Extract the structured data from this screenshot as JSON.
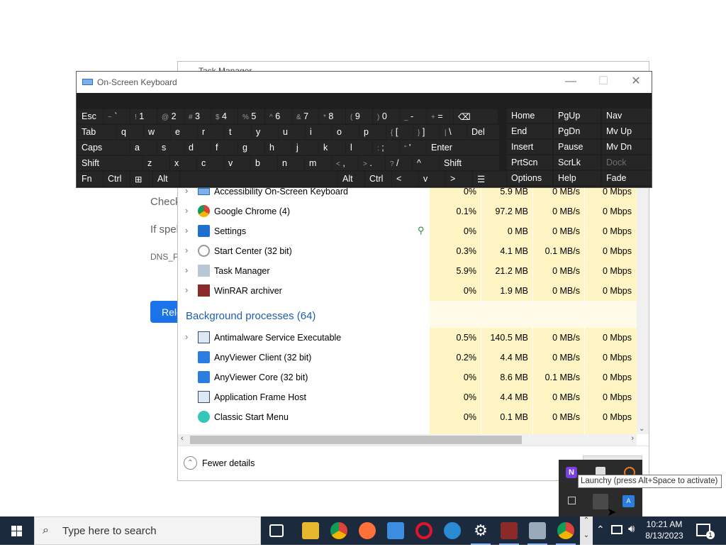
{
  "browser_page": {
    "check_text": "Check",
    "if_text": "If spel",
    "dns_text": "DNS_PI",
    "reload_label": "Relo"
  },
  "task_manager": {
    "title": "Task Manager",
    "apps": [
      {
        "name": "Accessibility On-Screen Keyboard",
        "cpu": "0%",
        "memory": "5.9 MB",
        "disk": "0 MB/s",
        "network": "0 Mbps",
        "icon": "keyboard-icon",
        "expandable": true
      },
      {
        "name": "Google Chrome (4)",
        "cpu": "0.1%",
        "memory": "97.2 MB",
        "disk": "0 MB/s",
        "network": "0 Mbps",
        "icon": "chrome-icon",
        "expandable": true
      },
      {
        "name": "Settings",
        "cpu": "0%",
        "memory": "0 MB",
        "disk": "0 MB/s",
        "network": "0 Mbps",
        "icon": "gear-icon",
        "expandable": true,
        "status": "leaf-icon"
      },
      {
        "name": "Start Center (32 bit)",
        "cpu": "0.3%",
        "memory": "4.1 MB",
        "disk": "0.1 MB/s",
        "network": "0 Mbps",
        "icon": "start-center-icon",
        "expandable": true
      },
      {
        "name": "Task Manager",
        "cpu": "5.9%",
        "memory": "21.2 MB",
        "disk": "0 MB/s",
        "network": "0 Mbps",
        "icon": "task-manager-icon",
        "expandable": true
      },
      {
        "name": "WinRAR archiver",
        "cpu": "0%",
        "memory": "1.9 MB",
        "disk": "0 MB/s",
        "network": "0 Mbps",
        "icon": "winrar-icon",
        "expandable": true
      }
    ],
    "background_header": "Background processes (64)",
    "background": [
      {
        "name": "Antimalware Service Executable",
        "cpu": "0.5%",
        "memory": "140.5 MB",
        "disk": "0 MB/s",
        "network": "0 Mbps",
        "icon": "service-icon",
        "expandable": true
      },
      {
        "name": "AnyViewer Client (32 bit)",
        "cpu": "0.2%",
        "memory": "4.4 MB",
        "disk": "0 MB/s",
        "network": "0 Mbps",
        "icon": "anyviewer-icon",
        "expandable": false
      },
      {
        "name": "AnyViewer Core (32 bit)",
        "cpu": "0%",
        "memory": "8.6 MB",
        "disk": "0.1 MB/s",
        "network": "0 Mbps",
        "icon": "anyviewer-icon",
        "expandable": false
      },
      {
        "name": "Application Frame Host",
        "cpu": "0%",
        "memory": "4.4 MB",
        "disk": "0 MB/s",
        "network": "0 Mbps",
        "icon": "service-icon",
        "expandable": false
      },
      {
        "name": "Classic Start Menu",
        "cpu": "0%",
        "memory": "0.1 MB",
        "disk": "0 MB/s",
        "network": "0 Mbps",
        "icon": "classic-start-icon",
        "expandable": false
      }
    ],
    "footer_label": "Fewer details"
  },
  "osk": {
    "title": "On-Screen Keyboard",
    "row1": [
      {
        "main": "Esc",
        "sub": ""
      },
      {
        "main": "`",
        "sub": "~"
      },
      {
        "main": "1",
        "sub": "!"
      },
      {
        "main": "2",
        "sub": "@"
      },
      {
        "main": "3",
        "sub": "#"
      },
      {
        "main": "4",
        "sub": "$"
      },
      {
        "main": "5",
        "sub": "%"
      },
      {
        "main": "6",
        "sub": "^"
      },
      {
        "main": "7",
        "sub": "&"
      },
      {
        "main": "8",
        "sub": "*"
      },
      {
        "main": "9",
        "sub": "("
      },
      {
        "main": "0",
        "sub": ")"
      },
      {
        "main": "-",
        "sub": "_"
      },
      {
        "main": "=",
        "sub": "+"
      },
      {
        "main": "⌫",
        "sub": ""
      }
    ],
    "row2": [
      "Tab",
      "q",
      "w",
      "e",
      "r",
      "t",
      "y",
      "u",
      "i",
      "o",
      "p",
      "[",
      "]",
      "\\",
      "Del"
    ],
    "row2_subs": [
      "",
      "",
      "",
      "",
      "",
      "",
      "",
      "",
      "",
      "",
      "",
      "{",
      "}",
      "|",
      ""
    ],
    "row3": [
      "Caps",
      "a",
      "s",
      "d",
      "f",
      "g",
      "h",
      "j",
      "k",
      "l",
      ";",
      "'",
      "Enter"
    ],
    "row3_subs": [
      "",
      "",
      "",
      "",
      "",
      "",
      "",
      "",
      "",
      "",
      ":",
      "\"",
      ""
    ],
    "row4": [
      "Shift",
      "z",
      "x",
      "c",
      "v",
      "b",
      "n",
      "m",
      ",",
      ".",
      "/",
      "^",
      "Shift"
    ],
    "row4_subs": [
      "",
      "",
      "",
      "",
      "",
      "",
      "",
      "",
      "<",
      ">",
      "?",
      "",
      ""
    ],
    "row5": [
      "Fn",
      "Ctrl",
      "⊞",
      "Alt",
      "",
      "Alt",
      "Ctrl",
      "<",
      "v",
      ">",
      "☰"
    ],
    "nav_col1": [
      "Home",
      "End",
      "Insert",
      "PrtScn",
      "Options"
    ],
    "nav_col2": [
      "PgUp",
      "PgDn",
      "Pause",
      "ScrLk",
      "Help"
    ],
    "nav_col3": [
      "Nav",
      "Mv Up",
      "Mv Dn",
      "Dock",
      "Fade"
    ]
  },
  "tray": {
    "tooltip": "Launchy (press Alt+Space to activate)"
  },
  "taskbar": {
    "search_placeholder": "Type here to search",
    "time": "10:21 AM",
    "date": "8/13/2023",
    "notification_count": "1"
  },
  "colors": {
    "taskbar": "#1c2a3e",
    "osk_key": "#262626",
    "tm_cell_light": "#fff4c4",
    "tm_cell_mid": "#ffefb0",
    "section_blue": "#1e5eb0"
  }
}
